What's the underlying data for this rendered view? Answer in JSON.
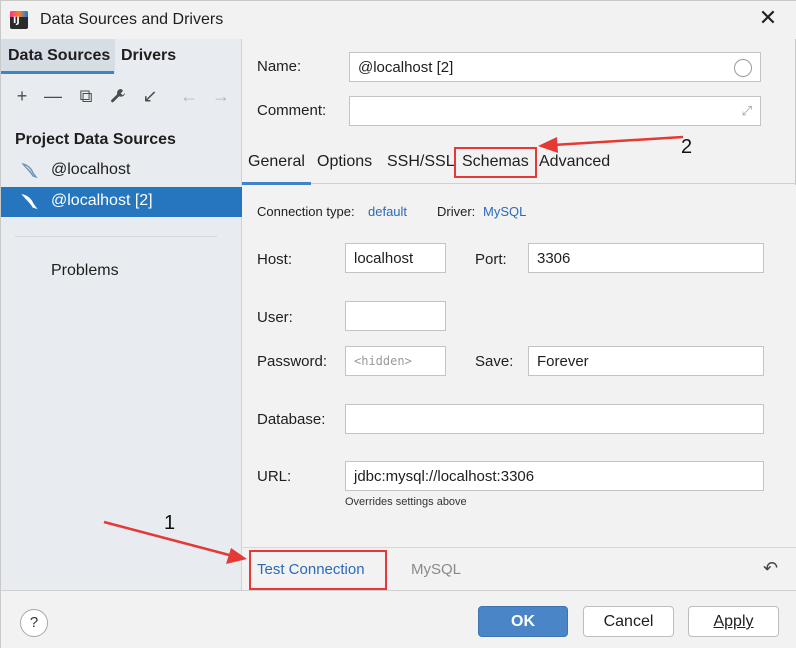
{
  "window": {
    "title": "Data Sources and Drivers",
    "close": "✕"
  },
  "left": {
    "tabs": [
      {
        "label": "Data Sources"
      },
      {
        "label": "Drivers"
      }
    ],
    "toolbar": {
      "add": "+",
      "remove": "—",
      "copy": "⧉",
      "settings": "🔧",
      "import": "↙",
      "back": "←",
      "forward": "→"
    },
    "section_title": "Project Data Sources",
    "items": [
      {
        "label": "@localhost"
      },
      {
        "label": "@localhost [2]"
      }
    ],
    "problems": "Problems"
  },
  "form": {
    "name_label": "Name:",
    "name_value": "@localhost [2]",
    "comment_label": "Comment:",
    "comment_value": ""
  },
  "tabs": [
    {
      "label": "General"
    },
    {
      "label": "Options"
    },
    {
      "label": "SSH/SSL"
    },
    {
      "label": "Schemas"
    },
    {
      "label": "Advanced"
    }
  ],
  "general": {
    "conn_type_label": "Connection type:",
    "conn_type_value": "default",
    "driver_label": "Driver:",
    "driver_value": "MySQL",
    "host_label": "Host:",
    "host_value": "localhost",
    "port_label": "Port:",
    "port_value": "3306",
    "user_label": "User:",
    "user_value": "",
    "password_label": "Password:",
    "password_placeholder": "<hidden>",
    "save_label": "Save:",
    "save_value": "Forever",
    "database_label": "Database:",
    "database_value": "",
    "url_label": "URL:",
    "url_value": "jdbc:mysql://localhost:3306",
    "url_hint": "Overrides settings above"
  },
  "actions": {
    "test_connection": "Test Connection",
    "mysql_link": "MySQL",
    "revert": "↶"
  },
  "footer": {
    "help": "?",
    "ok": "OK",
    "cancel": "Cancel",
    "apply": "Apply"
  },
  "annotations": {
    "label_1": "1",
    "label_2": "2",
    "color": "#e53935"
  }
}
